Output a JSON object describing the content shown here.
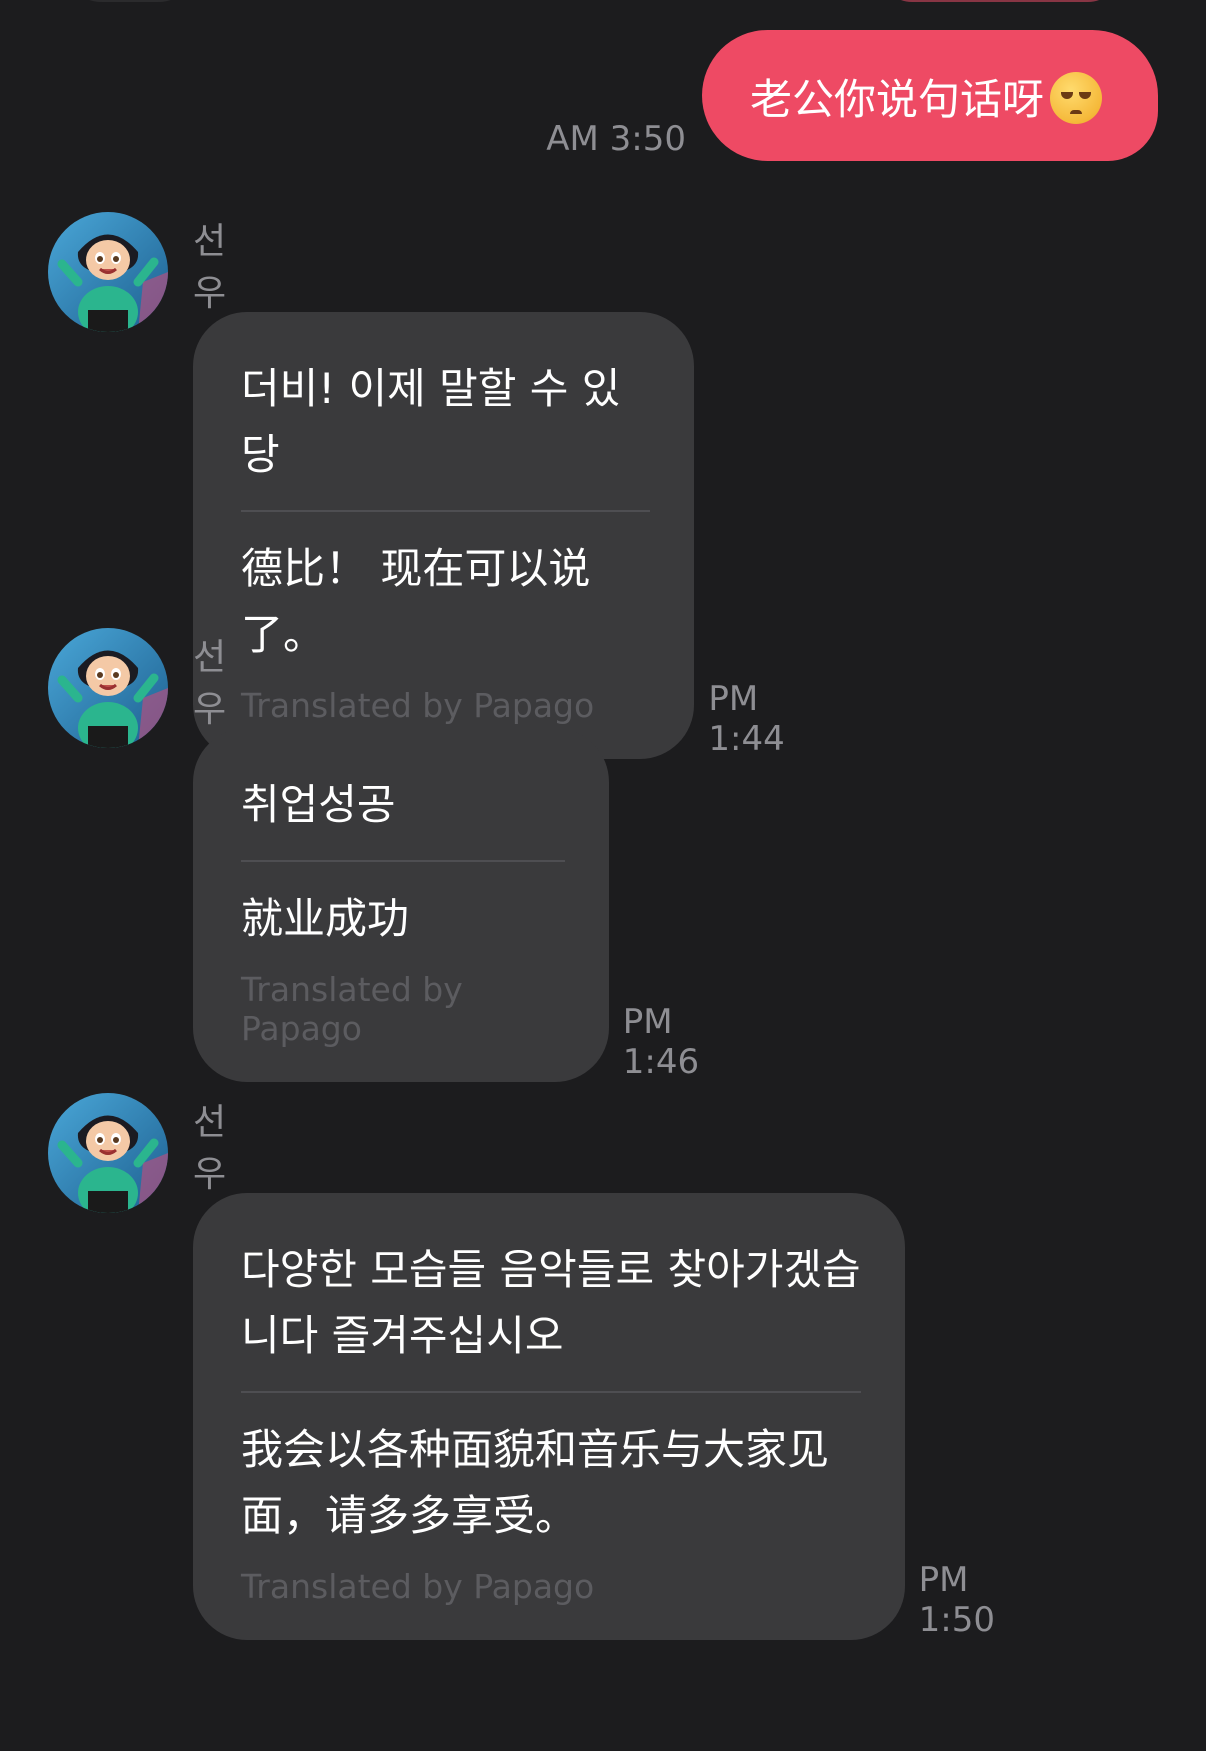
{
  "sent": {
    "text": "老公你说句话呀",
    "emoji": "pleading-face-emoji",
    "time": "AM 3:50"
  },
  "messages": [
    {
      "sender": "선우",
      "original": "더비! 이제 말할 수 있당",
      "translation": "德比！ 现在可以说了。",
      "credit": "Translated by Papago",
      "time": "PM 1:44"
    },
    {
      "sender": "선우",
      "original": "취업성공",
      "translation": "就业成功",
      "credit": "Translated by Papago",
      "time": "PM 1:46"
    },
    {
      "sender": "선우",
      "original": "다양한 모습들 음악들로 찾아가겠습니다 즐겨주십시오",
      "translation": "我会以各种面貌和音乐与大家见面，请多多享受。",
      "credit": "Translated by Papago",
      "time": "PM 1:50"
    }
  ],
  "colors": {
    "background": "#1c1c1e",
    "sent_bubble": "#ee4a64",
    "received_bubble": "#3a3a3c",
    "timestamp": "#8e8e93",
    "credit": "#5c5c60"
  }
}
